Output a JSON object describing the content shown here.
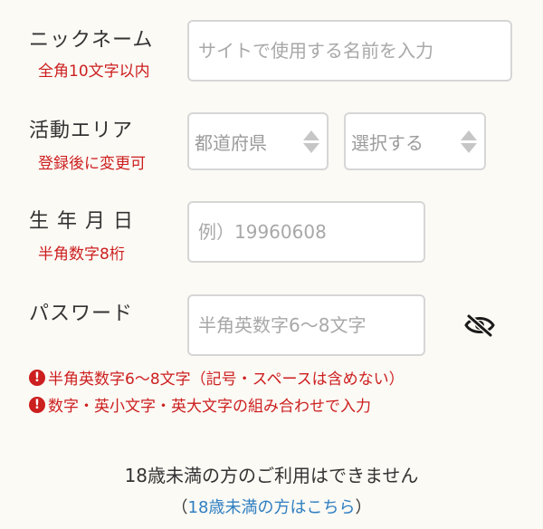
{
  "nickname": {
    "label": "ニックネーム",
    "hint": "全角10文字以内",
    "placeholder": "サイトで使用する名前を入力",
    "value": ""
  },
  "area": {
    "label": "活動エリア",
    "hint": "登録後に変更可",
    "prefecture": "都道府県",
    "city": "選択する"
  },
  "birthdate": {
    "label": "生 年 月 日",
    "hint": "半角数字8桁",
    "placeholder": "例）19960608",
    "value": ""
  },
  "password": {
    "label": "パスワード",
    "placeholder": "半角英数字6〜8文字",
    "value": "",
    "toggle_icon": "eye-slash-icon",
    "rules": [
      "半角英数字6〜8文字（記号・スペースは含めない）",
      "数字・英小文字・英大文字の組み合わせで入力"
    ],
    "error_icon": "!"
  },
  "age_notice": {
    "text": "18歳未満の方のご利用はできません",
    "link_open": "（",
    "link_text": "18歳未満の方はこちら",
    "link_close": "）"
  },
  "colors": {
    "background": "#fcfaf5",
    "error": "#cc1f1f",
    "link": "#2f7fc1",
    "border": "#d6d6d6"
  }
}
